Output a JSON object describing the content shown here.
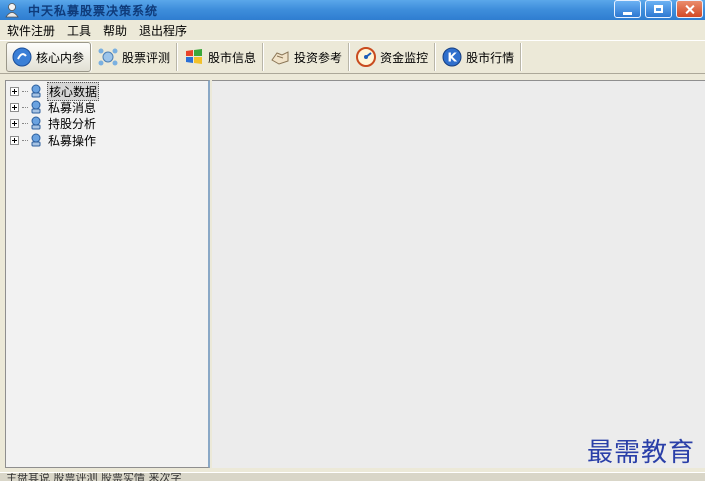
{
  "window": {
    "title": "中天私募股票决策系统",
    "icon": "person-app-icon"
  },
  "menu": [
    {
      "label": "软件注册"
    },
    {
      "label": "工具"
    },
    {
      "label": "帮助"
    },
    {
      "label": "退出程序"
    }
  ],
  "toolbar": [
    {
      "label": "核心内参",
      "icon": "blue-circle-icon"
    },
    {
      "label": "股票评测",
      "icon": "network-icon"
    },
    {
      "label": "股市信息",
      "icon": "windows-flag-icon"
    },
    {
      "label": "投资参考",
      "icon": "hand-icon"
    },
    {
      "label": "资金监控",
      "icon": "gauge-icon"
    },
    {
      "label": "股市行情",
      "icon": "k-circle-icon"
    }
  ],
  "tree": [
    {
      "label": "核心数据"
    },
    {
      "label": "私募消息"
    },
    {
      "label": "持股分析"
    },
    {
      "label": "私募操作"
    }
  ],
  "watermark": "最需教育",
  "status": "主盘其说 股票评测 股票实情 来次字"
}
